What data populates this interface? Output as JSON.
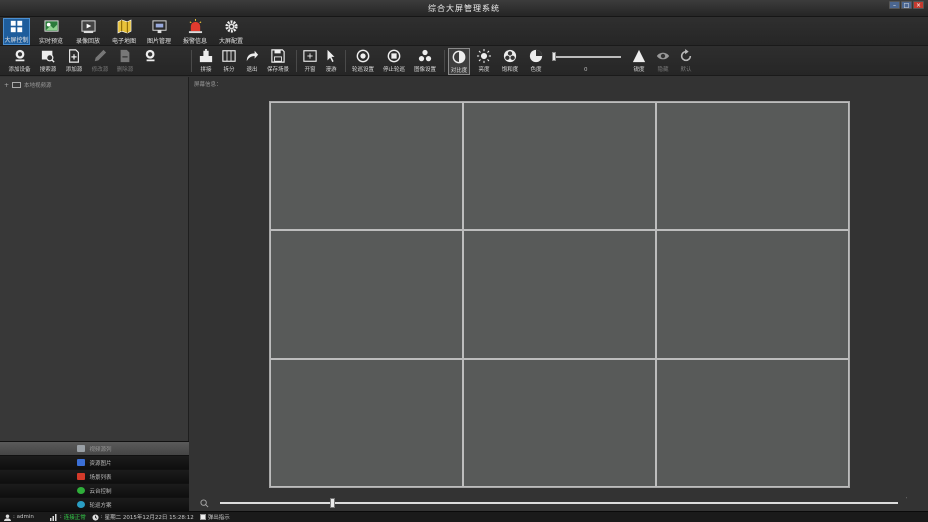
{
  "window": {
    "title": "综合大屏管理系统"
  },
  "nav": [
    {
      "label": "大屏控制",
      "icon": "grid-windows-icon"
    },
    {
      "label": "实时预览",
      "icon": "live-preview-icon"
    },
    {
      "label": "录像回放",
      "icon": "playback-icon"
    },
    {
      "label": "电子地图",
      "icon": "map-icon"
    },
    {
      "label": "图片管理",
      "icon": "image-manage-icon"
    },
    {
      "label": "报警信息",
      "icon": "alarm-icon"
    },
    {
      "label": "大屏配置",
      "icon": "gear-icon"
    }
  ],
  "left_toolbar": [
    {
      "label": "添加设备",
      "icon": "add-device-icon"
    },
    {
      "label": "搜索源",
      "icon": "search-source-icon"
    },
    {
      "label": "添加源",
      "icon": "add-source-icon"
    },
    {
      "label": "修改源",
      "icon": "edit-source-icon"
    },
    {
      "label": "删除源",
      "icon": "delete-source-icon"
    },
    {
      "label": "",
      "icon": "search-icon"
    }
  ],
  "right_toolbar": [
    {
      "label": "拼接",
      "icon": "splice-icon"
    },
    {
      "label": "拆分",
      "icon": "split-icon"
    },
    {
      "label": "退出",
      "icon": "exit-arrow-icon"
    },
    {
      "label": "保存场景",
      "icon": "save-scene-icon"
    },
    {
      "label": "开窗",
      "icon": "open-window-icon"
    },
    {
      "label": "漫游",
      "icon": "roam-cursor-icon"
    },
    {
      "label": "轮巡设置",
      "icon": "tour-settings-icon"
    },
    {
      "label": "停止轮巡",
      "icon": "stop-tour-icon"
    },
    {
      "label": "图像设置",
      "icon": "image-settings-icon"
    },
    {
      "label": "对比度",
      "icon": "contrast-icon"
    },
    {
      "label": "亮度",
      "icon": "brightness-icon"
    },
    {
      "label": "饱和度",
      "icon": "saturation-icon"
    },
    {
      "label": "色度",
      "icon": "hue-icon"
    },
    {
      "label": "锐度",
      "icon": "sharpness-icon"
    },
    {
      "label": "隐藏",
      "icon": "hide-eye-icon"
    },
    {
      "label": "默认",
      "icon": "reset-icon"
    }
  ],
  "image_slider": {
    "value": "0"
  },
  "tree": {
    "root": "本地视频源"
  },
  "main": {
    "screen_info": "屏幕信息："
  },
  "accordion": [
    {
      "label": "视频源列",
      "color": "#9aa0a6"
    },
    {
      "label": "资源图片",
      "color": "#3b6fd6"
    },
    {
      "label": "场景列表",
      "color": "#d43a2a"
    },
    {
      "label": "云台控制",
      "color": "#2fae3a"
    },
    {
      "label": "轮巡方案",
      "color": "#2a9ec4"
    }
  ],
  "status": {
    "user": ": admin",
    "connection": "连接正常",
    "datetime": "星期二 2015年12月22日 15:28:12",
    "popup": "弹出指示"
  }
}
